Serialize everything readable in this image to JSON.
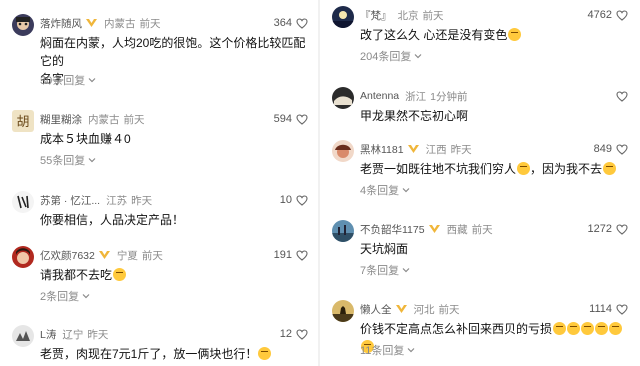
{
  "left": [
    {
      "name": "落炸随风",
      "vip": true,
      "loc": "内蒙古",
      "time": "前天",
      "likes": "364",
      "line1": "焖面在内蒙，人均20吃的很饱。这个价格比较匹配它的",
      "line2": "名字",
      "replies": "30条回复",
      "avatar_color": "#3b3b5c"
    },
    {
      "name": "糊里糊涂",
      "vip": false,
      "loc": "内蒙古",
      "time": "前天",
      "likes": "594",
      "line1": "成本５块血赚４0",
      "line2": "",
      "replies": "55条回复",
      "avatar_color": "#c9b27a",
      "avatar_char": "胡"
    },
    {
      "name": "苏第 · 忆江...",
      "vip": false,
      "loc": "江苏",
      "time": "昨天",
      "likes": "10",
      "line1": "你要相信，人品决定产品！",
      "line2": "",
      "replies": "",
      "avatar_color": "#ececec"
    },
    {
      "name": "亿欢颜7632",
      "vip": true,
      "loc": "宁夏",
      "time": "前天",
      "likes": "191",
      "line1": "请我都不去吃",
      "line2": "",
      "replies": "2条回复",
      "avatar_color": "#b1291f",
      "emoji": true
    },
    {
      "name": "L涛",
      "vip": false,
      "loc": "辽宁",
      "time": "昨天",
      "likes": "12",
      "line1": "老贾，肉现在7元1斤了，放一俩块也行！",
      "line2": "",
      "replies": "",
      "avatar_color": "#d9d9d9",
      "emoji": true
    }
  ],
  "right": [
    {
      "name": "『梵』",
      "vip": false,
      "loc": "北京",
      "time": "前天",
      "likes": "4762",
      "line1": "改了这么久 心还是没有变色",
      "line2": "",
      "replies": "204条回复",
      "avatar_color": "#1e2a4a",
      "emoji": true
    },
    {
      "name": "Antenna",
      "vip": false,
      "loc": "浙江",
      "time": "1分钟前",
      "likes": "",
      "line1": "甲龙果然不忘初心啊",
      "line2": "",
      "replies": "",
      "avatar_color": "#2b2b2b"
    },
    {
      "name": "黑林1181",
      "vip": true,
      "loc": "江西",
      "time": "昨天",
      "likes": "849",
      "line1": "老贾一如既往地不坑我们穷人",
      "line2": "",
      "replies": "4条回复",
      "avatar_color": "#d98a6a",
      "emoji": true,
      "tail": "，因为我不去"
    },
    {
      "name": "不负韶华1175",
      "vip": true,
      "loc": "西藏",
      "time": "前天",
      "likes": "1272",
      "line1": "天坑焖面",
      "line2": "",
      "replies": "7条回复",
      "avatar_color": "#3f6f8f"
    },
    {
      "name": "懒人全",
      "vip": true,
      "loc": "河北",
      "time": "前天",
      "likes": "1114",
      "line1": "价钱不定高点怎么补回来西贝的亏损",
      "line2": "",
      "replies": "11条回复",
      "avatar_color": "#c9a64a",
      "emoji6": true
    }
  ]
}
